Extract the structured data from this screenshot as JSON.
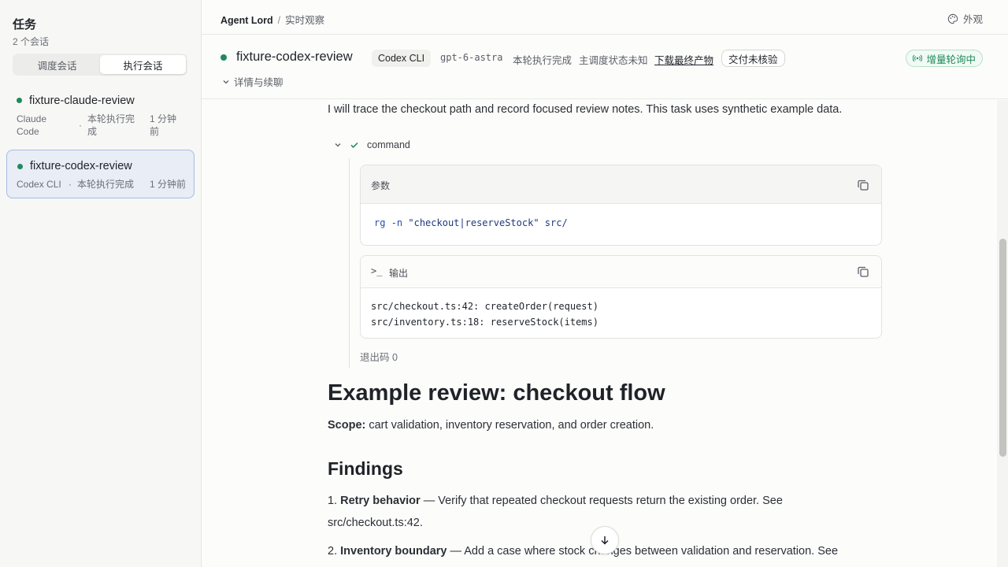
{
  "sidebar": {
    "title": "任务",
    "count": "2 个会话",
    "segments": [
      "调度会话",
      "执行会话"
    ],
    "sessions": [
      {
        "name": "fixture-claude-review",
        "agent_l1": "Claude",
        "agent_l2": "Code",
        "status_l1": "本轮执行完",
        "status_l2": "成",
        "time_l1": "1 分钟",
        "time_l2": "前",
        "sep": "·"
      },
      {
        "name": "fixture-codex-review",
        "agent": "Codex CLI",
        "status": "本轮执行完成",
        "time": "1 分钟前",
        "sep": "·"
      }
    ]
  },
  "breadcrumb": {
    "root": "Agent Lord",
    "sep": "/",
    "current": "实时观察"
  },
  "appearance_label": "外观",
  "session": {
    "name": "fixture-codex-review",
    "cli": "Codex CLI",
    "model": "gpt-6-astra",
    "status1": "本轮执行完成",
    "status2": "主调度状态未知",
    "download": "下载最终产物",
    "verify": "交付未核验",
    "live": "增量轮询中",
    "details": "详情与续聊"
  },
  "transcript": {
    "intro": "I will trace the checkout path and record focused review notes. This task uses synthetic example data.",
    "tool_name": "command",
    "params_label": "参数",
    "cmd": {
      "bin": "rg",
      "flag": "-n",
      "pattern": "\"checkout|reserveStock\"",
      "path": "src/"
    },
    "output_label": "输出",
    "term_glyph": ">_",
    "output": "src/checkout.ts:42: createOrder(request)\nsrc/inventory.ts:18: reserveStock(items)",
    "exit": "退出码 0",
    "h1": "Example review: checkout flow",
    "scope_label": "Scope:",
    "scope_text": " cart validation, inventory reservation, and order creation.",
    "h2": "Findings",
    "findings": [
      {
        "num": "1.",
        "title": "Retry behavior",
        "text": " — Verify that repeated checkout requests return the existing order. See src/checkout.ts:42."
      },
      {
        "num": "2.",
        "title": "Inventory boundary",
        "text": " — Add a case where stock changes between validation and reservation. See"
      }
    ]
  },
  "colors": {
    "accent_green": "#1f8a5b",
    "selected_bg": "#e8edf6",
    "selected_border": "#a8bde0"
  }
}
